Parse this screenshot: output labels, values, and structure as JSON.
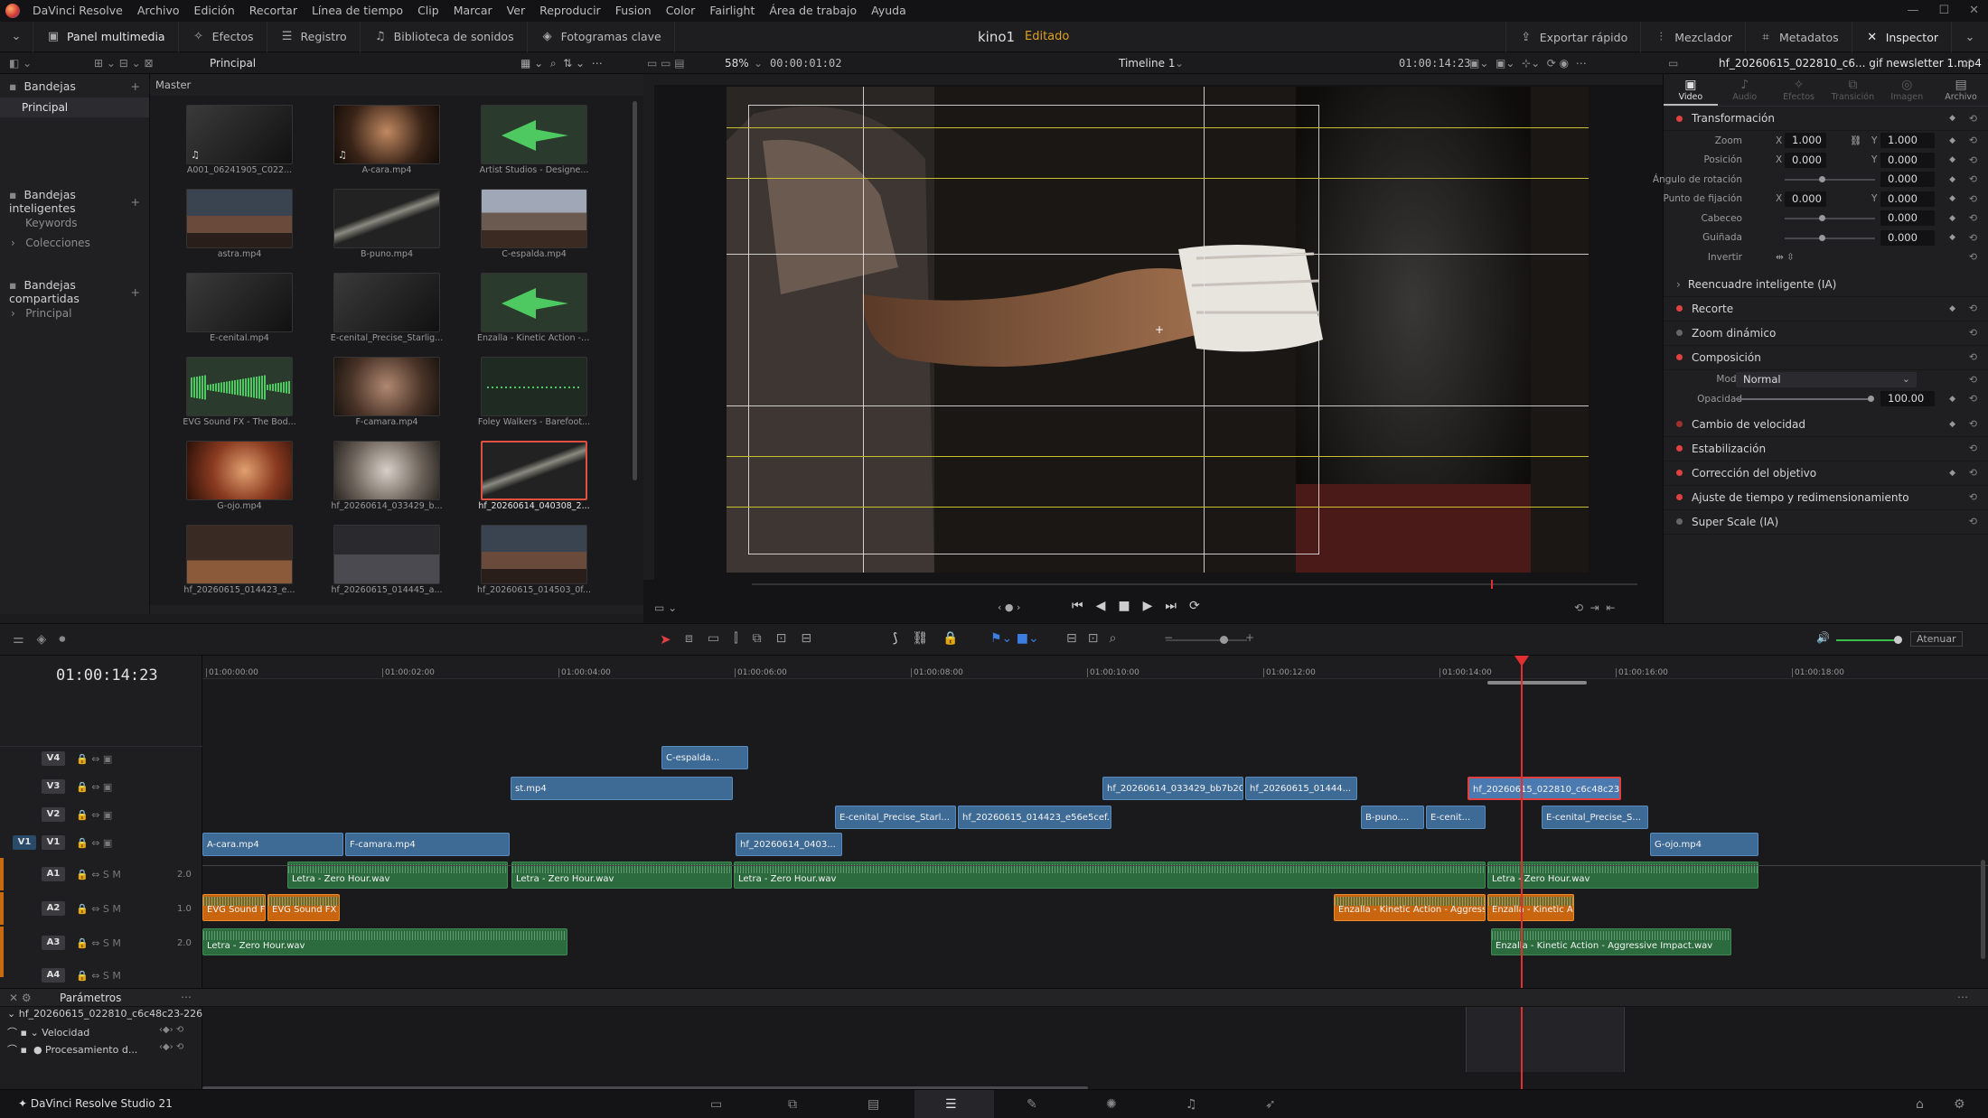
{
  "menu": {
    "app": "DaVinci Resolve",
    "items": [
      "Archivo",
      "Edición",
      "Recortar",
      "Línea de tiempo",
      "Clip",
      "Marcar",
      "Ver",
      "Reproducir",
      "Fusion",
      "Color",
      "Fairlight",
      "Área de trabajo",
      "Ayuda"
    ]
  },
  "toolbar": {
    "left": [
      "Panel multimedia",
      "Efectos",
      "Registro",
      "Biblioteca de sonidos",
      "Fotogramas clave"
    ],
    "project": "kino1",
    "status": "Editado",
    "right": [
      "Exportar rápido",
      "Mezclador",
      "Metadatos",
      "Inspector"
    ]
  },
  "subbar": {
    "bin_title": "Principal",
    "zoom": "58%",
    "timecode": "00:00:01:02",
    "timeline": "Timeline 1",
    "viewer_tc": "01:00:14:23",
    "clip_name": "hf_20260615_022810_c6... gif newsletter 1.mp4"
  },
  "bins": {
    "header": "Bandejas",
    "selected": "Principal",
    "smart_header": "Bandejas inteligentes",
    "smart_items": [
      "Keywords",
      "Colecciones"
    ],
    "shared_header": "Bandejas compartidas",
    "shared_items": [
      "Principal"
    ]
  },
  "media": {
    "path": "Master",
    "clips": [
      {
        "name": "A001_06241905_C022...",
        "thumb": "dark",
        "note": true
      },
      {
        "name": "A-cara.mp4",
        "thumb": "face",
        "note": true
      },
      {
        "name": "Artist Studios - Designe...",
        "thumb": "audio"
      },
      {
        "name": "astra.mp4",
        "thumb": "stretch"
      },
      {
        "name": "B-puno.mp4",
        "thumb": "beam"
      },
      {
        "name": "C-espalda.mp4",
        "thumb": "sunset"
      },
      {
        "name": "E-cenital.mp4",
        "thumb": "dark"
      },
      {
        "name": "E-cenital_Precise_Starlig...",
        "thumb": "dark"
      },
      {
        "name": "Enzalla - Kinetic Action - ...",
        "thumb": "audio"
      },
      {
        "name": "EVG Sound FX - The Bod...",
        "thumb": "wave"
      },
      {
        "name": "F-camara.mp4",
        "thumb": "face2"
      },
      {
        "name": "Foley Walkers - Barefoot...",
        "thumb": "flat"
      },
      {
        "name": "G-ojo.mp4",
        "thumb": "eye"
      },
      {
        "name": "hf_20260614_033429_b...",
        "thumb": "drink"
      },
      {
        "name": "hf_20260614_040308_2...",
        "thumb": "beam",
        "selected": true
      },
      {
        "name": "hf_20260615_014423_e...",
        "thumb": "sprint"
      },
      {
        "name": "hf_20260615_014445_a...",
        "thumb": "gym"
      },
      {
        "name": "hf_20260615_014503_0f...",
        "thumb": "stretch"
      }
    ]
  },
  "inspector": {
    "tabs": [
      "Video",
      "Audio",
      "Efectos",
      "Transición",
      "Imagen",
      "Archivo"
    ],
    "transform": {
      "title": "Transformación",
      "zoom_label": "Zoom",
      "zoom_x": "1.000",
      "zoom_y": "1.000",
      "pos_label": "Posición",
      "pos_x": "0.000",
      "pos_y": "0.000",
      "rot_label": "Ángulo de rotación",
      "rot": "0.000",
      "anchor_label": "Punto de fijación",
      "anchor_x": "0.000",
      "anchor_y": "0.000",
      "pitch_label": "Cabeceo",
      "pitch": "0.000",
      "yaw_label": "Guiñada",
      "yaw": "0.000",
      "flip_label": "Invertir"
    },
    "sections": {
      "smart_reframe": "Reencuadre inteligente (IA)",
      "crop": "Recorte",
      "dyn_zoom": "Zoom dinámico",
      "composite": "Composición",
      "mode_label": "Modo",
      "mode": "Normal",
      "opacity_label": "Opacidad",
      "opacity": "100.00",
      "speed": "Cambio de velocidad",
      "stab": "Estabilización",
      "lens": "Corrección del objetivo",
      "retime": "Ajuste de tiempo y redimensionamiento",
      "superscale": "Super Scale (IA)"
    }
  },
  "timeline": {
    "tc": "01:00:14:23",
    "ruler": [
      "01:00:00:00",
      "01:00:02:00",
      "01:00:04:00",
      "01:00:06:00",
      "01:00:08:00",
      "01:00:10:00",
      "01:00:12:00",
      "01:00:14:00",
      "01:00:16:00",
      "01:00:18:00"
    ],
    "tracks": {
      "v4": "V4",
      "v3": "V3",
      "v2": "V2",
      "v1": "V1",
      "a1": "A1",
      "a2": "A2",
      "a3": "A3",
      "a4": "A4",
      "a1_vol": "2.0",
      "a2_vol": "1.0",
      "a3_vol": "2.0"
    },
    "attenuate": "Atenuar",
    "clips": {
      "c_espalda": "C-espalda...",
      "st": "st.mp4",
      "hf033429": "hf_20260614_033429_bb7b206f...",
      "hf01444": "hf_20260615_01444...",
      "hf022810": "hf_20260615_022810_c6c48c23-226...",
      "ecenital": "E-cenital_Precise_Starl...",
      "hf014423": "hf_20260615_014423_e56e5cef...",
      "bpuno": "B-puno....",
      "ecenit": "E-cenit...",
      "ecenital2": "E-cenital_Precise_S...",
      "acara": "A-cara.mp4",
      "fcamara": "F-camara.mp4",
      "hf0403": "hf_20260614_0403...",
      "gojo": "G-ojo.mp4",
      "letra1": "Letra - Zero Hour.wav",
      "letra2": "Letra - Zero Hour.wav",
      "letra3": "Letra - Zero Hour.wav",
      "letra4": "Letra - Zero Hour.wav",
      "evg1": "EVG Sound F...",
      "evg2": "EVG Sound FX ...",
      "enz1": "Enzalla - Kinetic Action - Aggressive...",
      "enz2": "Enzalla - Kinetic Ac...",
      "letra5": "Letra - Zero Hour.wav",
      "enz3": "Enzalla - Kinetic Action - Aggressive Impact.wav"
    }
  },
  "params": {
    "title": "Parámetros",
    "clip": "hf_20260615_022810_c6c48c23-226...",
    "speed": "Velocidad",
    "proc": "Procesamiento d..."
  },
  "status": {
    "app": "DaVinci Resolve Studio 21"
  }
}
